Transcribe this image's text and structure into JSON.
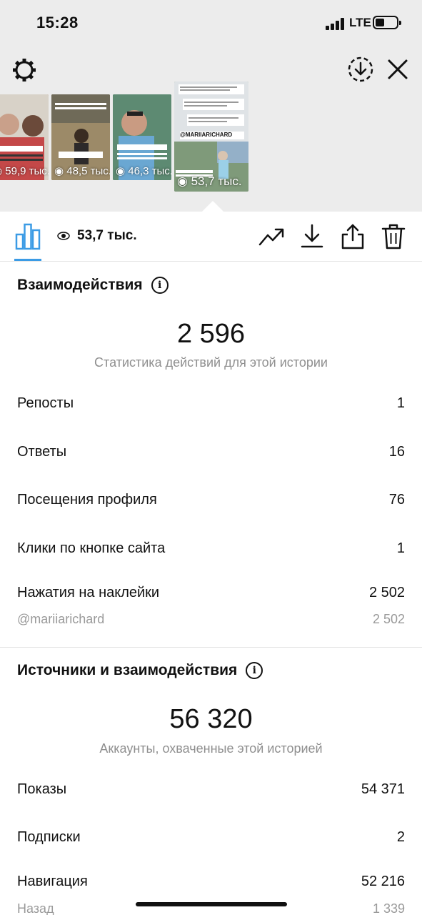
{
  "status": {
    "time": "15:28",
    "network": "LTE"
  },
  "thumbnails": [
    {
      "views": "59,9 тыс.",
      "bg": "#b8775e"
    },
    {
      "views": "48,5 тыс.",
      "bg": "#8e7a55"
    },
    {
      "views": "46,3 тыс.",
      "bg": "#4c6f78"
    },
    {
      "views": "53,7 тыс.",
      "bg": "#8a9a6a",
      "handle": "@MARIIARICHARD"
    }
  ],
  "toolbar": {
    "views": "53,7 тыс.",
    "accent": "#3b9be5"
  },
  "interactions": {
    "title": "Взаимодействия",
    "total": "2 596",
    "subtitle": "Статистика действий для этой истории",
    "rows": [
      {
        "label": "Репосты",
        "value": "1"
      },
      {
        "label": "Ответы",
        "value": "16"
      },
      {
        "label": "Посещения профиля",
        "value": "76"
      },
      {
        "label": "Клики по кнопке сайта",
        "value": "1"
      },
      {
        "label": "Нажатия на наклейки",
        "value": "2 502"
      }
    ],
    "sticker_detail": {
      "label": "@mariiarichard",
      "value": "2 502"
    }
  },
  "sources": {
    "title": "Источники и взаимодействия",
    "total": "56 320",
    "subtitle": "Аккаунты, охваченные этой историей",
    "rows": [
      {
        "label": "Показы",
        "value": "54 371"
      },
      {
        "label": "Подписки",
        "value": "2"
      },
      {
        "label": "Навигация",
        "value": "52 216"
      }
    ],
    "back_detail": {
      "label": "Назад",
      "value": "1 339"
    }
  }
}
